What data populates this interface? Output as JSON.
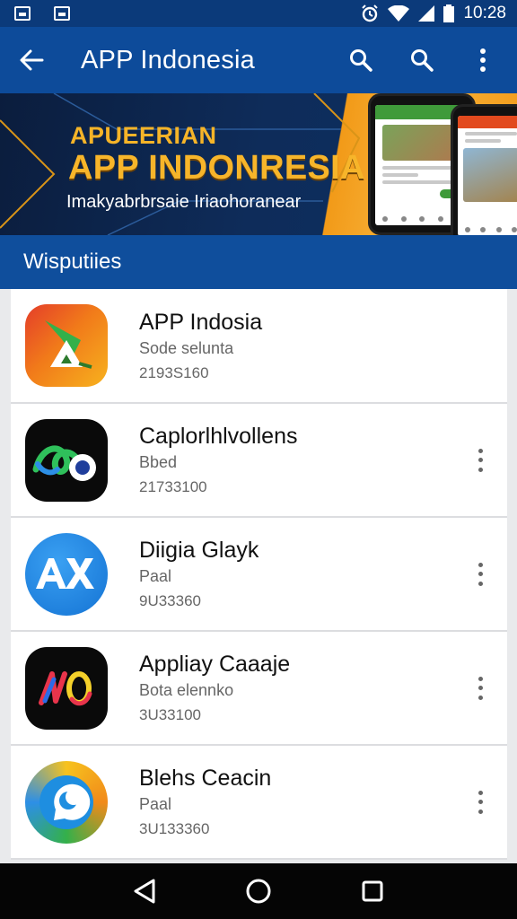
{
  "status_bar": {
    "time": "10:28"
  },
  "app_bar": {
    "title": "APP Indonesia"
  },
  "banner": {
    "eyebrow": "APUEERIAN",
    "headline": "APP INDONRESIA",
    "tagline": "Imakyabrbrsaie Iriaohoranear"
  },
  "section": {
    "title": "Wisputiies"
  },
  "apps": [
    {
      "name": "APP Indosia",
      "category": "Sode selunta",
      "count": "2193S160",
      "icon": "green-yellow-orange-icon",
      "has_menu": false
    },
    {
      "name": "Caplorlhlvollens",
      "category": "Bbed",
      "count": "21733100",
      "icon": "green-blue-loop-icon",
      "has_menu": true
    },
    {
      "name": "Diigia Glayk",
      "category": "Paal",
      "count": "9U33360",
      "icon": "ax-letter-icon",
      "has_menu": true
    },
    {
      "name": "Appliay Caaaje",
      "category": "Bota elennko",
      "count": "3U33100",
      "icon": "neon-scribble-icon",
      "has_menu": true
    },
    {
      "name": "Blehs Ceacin",
      "category": "Paal",
      "count": "3U133360",
      "icon": "chat-bubble-icon",
      "has_menu": true
    }
  ],
  "colors": {
    "status_bar": "#0b3a7a",
    "app_bar": "#0d4b9a",
    "section_bar": "#0f4e9c",
    "banner_accent": "#f7b52a"
  }
}
